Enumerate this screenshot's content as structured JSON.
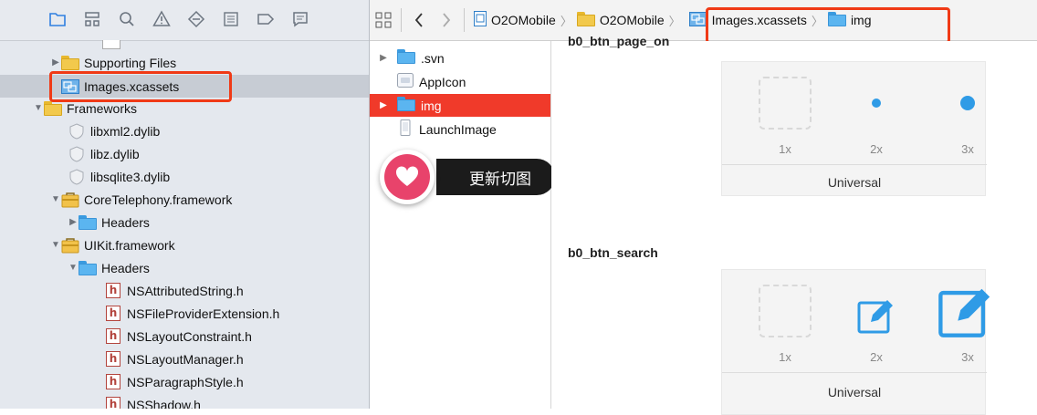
{
  "navigator": {
    "toolbar_icons": [
      "folder-icon",
      "hierarchy-icon",
      "search-icon",
      "warning-icon",
      "diamond-icon",
      "list-icon",
      "tag-icon",
      "chat-icon"
    ],
    "items": [
      {
        "label": "Supporting Files",
        "icon": "folder-yellow"
      },
      {
        "label": "Images.xcassets",
        "icon": "xcassets"
      },
      {
        "label": "Frameworks",
        "icon": "folder-yellow"
      },
      {
        "label": "libxml2.dylib",
        "icon": "dylib"
      },
      {
        "label": "libz.dylib",
        "icon": "dylib"
      },
      {
        "label": "libsqlite3.dylib",
        "icon": "dylib"
      },
      {
        "label": "CoreTelephony.framework",
        "icon": "framework"
      },
      {
        "label": "Headers",
        "icon": "folder-blue"
      },
      {
        "label": "UIKit.framework",
        "icon": "framework"
      },
      {
        "label": "Headers",
        "icon": "folder-blue"
      },
      {
        "label": "NSAttributedString.h",
        "icon": "h"
      },
      {
        "label": "NSFileProviderExtension.h",
        "icon": "h"
      },
      {
        "label": "NSLayoutConstraint.h",
        "icon": "h"
      },
      {
        "label": "NSLayoutManager.h",
        "icon": "h"
      },
      {
        "label": "NSParagraphStyle.h",
        "icon": "h"
      },
      {
        "label": "NSShadow.h",
        "icon": "h"
      }
    ],
    "h_glyph": "h"
  },
  "jumpbar": {
    "crumbs": [
      "O2OMobile",
      "O2OMobile",
      "Images.xcassets",
      "img"
    ]
  },
  "assets": {
    "items": [
      ".svn",
      "AppIcon",
      "img",
      "LaunchImage"
    ],
    "selected_index": 2
  },
  "toast": {
    "text": "更新切图",
    "color": "#e8436b"
  },
  "detail": {
    "sets": [
      {
        "name": "b0_btn_page_on",
        "scales": [
          "1x",
          "2x",
          "3x"
        ],
        "universal": "Universal"
      },
      {
        "name": "b0_btn_search",
        "scales": [
          "1x",
          "2x",
          "3x"
        ],
        "universal": "Universal"
      }
    ]
  },
  "colors": {
    "highlight": "#f03a16",
    "selection": "#f03a2a",
    "accent": "#2f9be6"
  }
}
